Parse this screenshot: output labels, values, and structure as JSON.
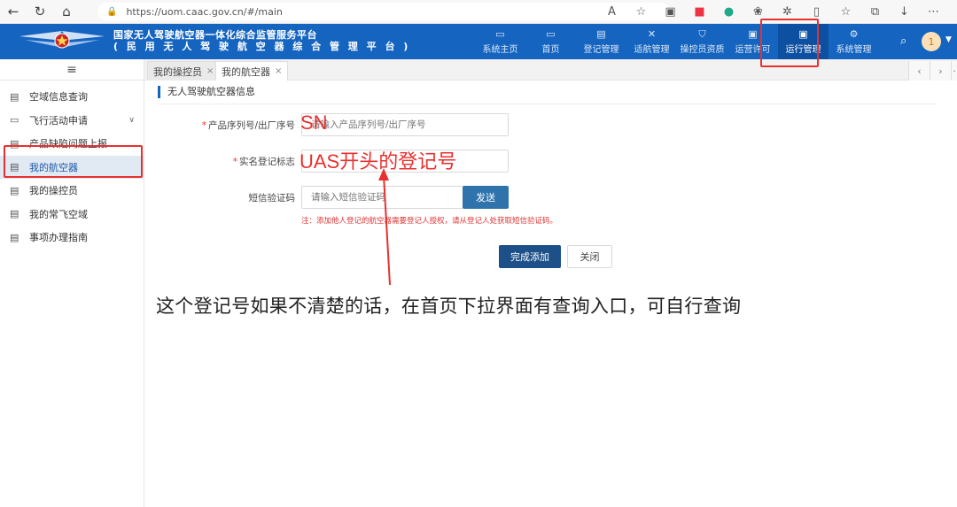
{
  "browser": {
    "url": "https://uom.caac.gov.cn/#/main"
  },
  "header": {
    "title_line1": "国家无人驾驶航空器一体化综合监管服务平台",
    "title_line2": "( 民 用 无 人 驾 驶 航 空 器 综 合 管 理 平 台 )",
    "nav": [
      {
        "label": "系统主页",
        "icon": "home-grid-icon"
      },
      {
        "label": "首页",
        "icon": "monitor-icon"
      },
      {
        "label": "登记管理",
        "icon": "register-doc-icon"
      },
      {
        "label": "适航管理",
        "icon": "drone-icon"
      },
      {
        "label": "操控员资质",
        "icon": "shield-icon"
      },
      {
        "label": "运营许可",
        "icon": "license-icon"
      },
      {
        "label": "运行管理",
        "icon": "operation-icon"
      },
      {
        "label": "系统管理",
        "icon": "settings-grid-icon"
      }
    ],
    "avatar_text": "1"
  },
  "sidebar": {
    "items": [
      {
        "label": "空域信息查询"
      },
      {
        "label": "飞行活动申请"
      },
      {
        "label": "产品缺陷问题上报"
      },
      {
        "label": "我的航空器"
      },
      {
        "label": "我的操控员"
      },
      {
        "label": "我的常飞空域"
      },
      {
        "label": "事项办理指南"
      }
    ]
  },
  "tabs": [
    {
      "label": "我的操控员"
    },
    {
      "label": "我的航空器"
    }
  ],
  "form": {
    "section_title": "无人驾驶航空器信息",
    "serial_label": "产品序列号/出厂序号",
    "serial_placeholder": "请输入产品序列号/出厂序号",
    "reg_label": "实名登记标志",
    "reg_placeholder": "",
    "sms_label": "短信验证码",
    "sms_placeholder": "请输入短信验证码",
    "send_label": "发送",
    "note": "注：添加他人登记的航空器需要登记人授权，请从登记人处获取短信验证码。",
    "submit_label": "完成添加",
    "close_label": "关闭"
  },
  "annotations": {
    "sn": "SN",
    "uas": "UAS开头的登记号",
    "caption": "这个登记号如果不清楚的话，在首页下拉界面有查询入口，可自行查询",
    "color": "#e8312f"
  }
}
